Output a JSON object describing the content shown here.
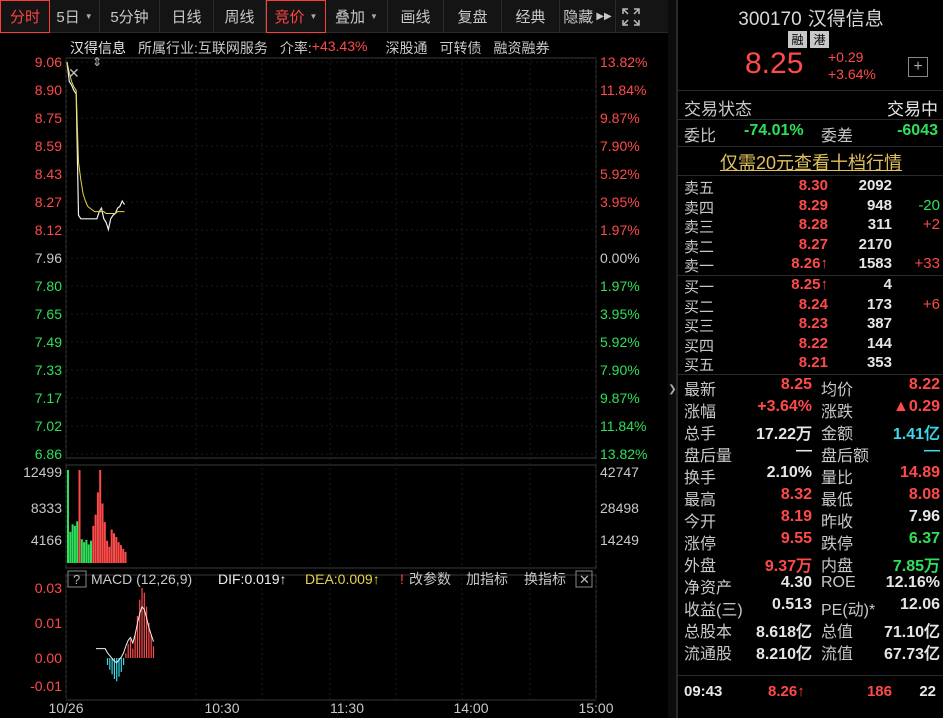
{
  "toolbar": {
    "items": [
      "分时",
      "5日",
      "5分钟",
      "日线",
      "周线",
      "竞价",
      "叠加",
      "画线",
      "复盘",
      "经典",
      "隐藏"
    ],
    "active": "竞价"
  },
  "info": {
    "name": "汉得信息",
    "industry_label": "所属行业:",
    "industry": "互联网服务",
    "premium_label": "介率:",
    "premium": "+43.43%",
    "tags": [
      "深股通",
      "可转债",
      "融资融券"
    ]
  },
  "price_axis": {
    "left": [
      "9.06",
      "8.90",
      "8.75",
      "8.59",
      "8.43",
      "8.27",
      "8.12",
      "7.96",
      "7.80",
      "7.65",
      "7.49",
      "7.33",
      "7.17",
      "7.02",
      "6.86"
    ],
    "right": [
      "13.82%",
      "11.84%",
      "9.87%",
      "7.90%",
      "5.92%",
      "3.95%",
      "1.97%",
      "0.00%",
      "1.97%",
      "3.95%",
      "5.92%",
      "7.90%",
      "9.87%",
      "11.84%",
      "13.82%"
    ]
  },
  "volume_axis": {
    "left": [
      "12499",
      "8333",
      "4166"
    ],
    "right": [
      "42747",
      "28498",
      "14249"
    ]
  },
  "macd": {
    "label": "MACD (12,26,9)",
    "dif": "DIF:0.019↑",
    "dea": "DEA:0.009↑",
    "links": [
      "改参数",
      "加指标",
      "换指标"
    ],
    "axis": [
      "0.03",
      "0.01",
      "0.00",
      "-0.01"
    ]
  },
  "time_axis": [
    "10/26",
    "10:30",
    "11:30",
    "14:00",
    "15:00"
  ],
  "chart_data": {
    "type": "line",
    "x_domain": [
      "09:30",
      "15:00"
    ],
    "price_ylim": [
      6.86,
      9.06
    ],
    "prev_close": 7.96,
    "price": [
      9.06,
      8.95,
      8.93,
      8.9,
      8.88,
      8.2,
      8.18,
      8.18,
      8.18,
      8.18,
      8.18,
      8.18,
      8.18,
      8.18,
      8.22,
      8.24,
      8.18,
      8.16,
      8.12,
      8.18,
      8.2,
      8.21,
      8.24,
      8.25,
      8.28,
      8.26
    ],
    "avg": [
      9.06,
      9.0,
      8.95,
      8.92,
      8.9,
      8.5,
      8.4,
      8.32,
      8.28,
      8.25,
      8.24,
      8.23,
      8.22,
      8.22,
      8.22,
      8.22,
      8.22,
      8.21,
      8.21,
      8.21,
      8.21,
      8.21,
      8.22,
      8.22,
      8.22,
      8.22
    ],
    "volume_ylim": [
      0,
      12499
    ],
    "volume": [
      12499,
      4200,
      5200,
      5000,
      5600,
      12499,
      3200,
      2800,
      3100,
      2500,
      3000,
      5000,
      6500,
      9500,
      12499,
      8000,
      5500,
      3000,
      2200,
      4500,
      4000,
      3500,
      2800,
      2400,
      1900,
      1500
    ],
    "volume_up": [
      true,
      true,
      true,
      true,
      true,
      false,
      true,
      true,
      true,
      true,
      true,
      false,
      false,
      false,
      false,
      false,
      false,
      false,
      false,
      false,
      false,
      false,
      false,
      false,
      false,
      false
    ],
    "macd_ylim": [
      -0.01,
      0.03
    ],
    "macd": [
      0.0,
      0.0,
      0.0,
      0.0,
      0.0,
      -0.003,
      -0.005,
      -0.007,
      -0.009,
      -0.01,
      -0.008,
      -0.006,
      -0.003,
      0.002,
      0.006,
      0.008,
      0.004,
      0.01,
      0.018,
      0.025,
      0.03,
      0.028,
      0.022,
      0.015,
      0.01,
      0.005
    ]
  },
  "quote": {
    "code": "300170",
    "name": "汉得信息",
    "tags": [
      "融",
      "港"
    ],
    "price": "8.25",
    "change": "+0.29",
    "change_pct": "+3.64%",
    "status_label": "交易状态",
    "status": "交易中",
    "wb_label": "委比",
    "wb": "-74.01%",
    "wc_label": "委差",
    "wc": "-6043",
    "upsell": "仅需20元查看十档行情"
  },
  "orderbook": {
    "asks": [
      {
        "label": "卖五",
        "price": "8.30",
        "qty": "2092",
        "delta": ""
      },
      {
        "label": "卖四",
        "price": "8.29",
        "qty": "948",
        "delta": "-20"
      },
      {
        "label": "卖三",
        "price": "8.28",
        "qty": "311",
        "delta": "+2"
      },
      {
        "label": "卖二",
        "price": "8.27",
        "qty": "2170",
        "delta": ""
      },
      {
        "label": "卖一",
        "price": "8.26↑",
        "qty": "1583",
        "delta": "+33"
      }
    ],
    "bids": [
      {
        "label": "买一",
        "price": "8.25↑",
        "qty": "4",
        "delta": ""
      },
      {
        "label": "买二",
        "price": "8.24",
        "qty": "173",
        "delta": "+6"
      },
      {
        "label": "买三",
        "price": "8.23",
        "qty": "387",
        "delta": ""
      },
      {
        "label": "买四",
        "price": "8.22",
        "qty": "144",
        "delta": ""
      },
      {
        "label": "买五",
        "price": "8.21",
        "qty": "353",
        "delta": ""
      }
    ]
  },
  "stats": [
    {
      "l1": "最新",
      "v1": "8.25",
      "c1": "#ff4a4a",
      "l2": "均价",
      "v2": "8.22",
      "c2": "#ff4a4a"
    },
    {
      "l1": "涨幅",
      "v1": "+3.64%",
      "c1": "#ff4a4a",
      "l2": "涨跌",
      "v2": "▲0.29",
      "c2": "#ff4a4a"
    },
    {
      "l1": "总手",
      "v1": "17.22万",
      "c1": "#e6e6e6",
      "l2": "金额",
      "v2": "1.41亿",
      "c2": "#3ad8e8"
    },
    {
      "l1": "盘后量",
      "v1": "—",
      "c1": "#e6e6e6",
      "l2": "盘后额",
      "v2": "—",
      "c2": "#3ad8e8"
    },
    {
      "l1": "换手",
      "v1": "2.10%",
      "c1": "#e6e6e6",
      "l2": "量比",
      "v2": "14.89",
      "c2": "#ff4a4a"
    },
    {
      "l1": "最高",
      "v1": "8.32",
      "c1": "#ff4a4a",
      "l2": "最低",
      "v2": "8.08",
      "c2": "#ff4a4a"
    },
    {
      "l1": "今开",
      "v1": "8.19",
      "c1": "#ff4a4a",
      "l2": "昨收",
      "v2": "7.96",
      "c2": "#e6e6e6"
    },
    {
      "l1": "涨停",
      "v1": "9.55",
      "c1": "#ff4a4a",
      "l2": "跌停",
      "v2": "6.37",
      "c2": "#2ee05a"
    },
    {
      "l1": "外盘",
      "v1": "9.37万",
      "c1": "#ff4a4a",
      "l2": "内盘",
      "v2": "7.85万",
      "c2": "#2ee05a"
    },
    {
      "l1": "净资产",
      "v1": "4.30",
      "c1": "#e6e6e6",
      "l2": "ROE",
      "v2": "12.16%",
      "c2": "#e6e6e6"
    },
    {
      "l1": "收益(三)",
      "v1": "0.513",
      "c1": "#e6e6e6",
      "l2": "PE(动)*",
      "v2": "12.06",
      "c2": "#e6e6e6"
    },
    {
      "l1": "总股本",
      "v1": "8.618亿",
      "c1": "#e6e6e6",
      "l2": "总值",
      "v2": "71.10亿",
      "c2": "#e6e6e6"
    },
    {
      "l1": "流通股",
      "v1": "8.210亿",
      "c1": "#e6e6e6",
      "l2": "流值",
      "v2": "67.73亿",
      "c2": "#e6e6e6"
    }
  ],
  "tick": {
    "time": "09:43",
    "price": "8.26↑",
    "vol": "186",
    "count": "22"
  },
  "colors": {
    "up": "#ff4a4a",
    "down": "#2ee05a",
    "cyan": "#3ad8e8",
    "gold": "#e0c15a"
  }
}
